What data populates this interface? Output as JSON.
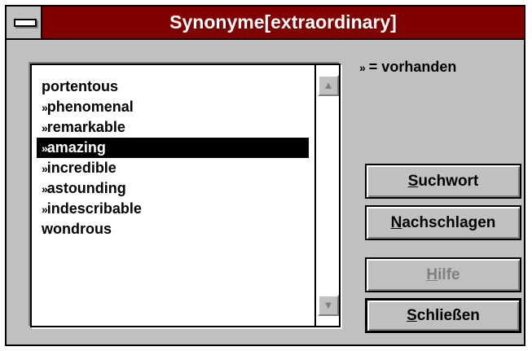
{
  "window": {
    "title": "Synonyme[extraordinary]"
  },
  "legend": {
    "marker": "»",
    "text": " = vorhanden"
  },
  "synonyms": {
    "items": [
      {
        "marker": "",
        "label": "portentous"
      },
      {
        "marker": "»",
        "label": "phenomenal"
      },
      {
        "marker": "»",
        "label": "remarkable"
      },
      {
        "marker": "»",
        "label": "amazing",
        "selected": true
      },
      {
        "marker": "»",
        "label": "incredible"
      },
      {
        "marker": "»",
        "label": "astounding"
      },
      {
        "marker": "»",
        "label": "indescribable"
      },
      {
        "marker": "",
        "label": "wondrous"
      }
    ]
  },
  "buttons": {
    "suchwort": {
      "accel": "S",
      "rest": "uchwort"
    },
    "nachschlagen": {
      "accel": "N",
      "rest": "achschlagen"
    },
    "hilfe": {
      "accel": "H",
      "rest": "ilfe",
      "enabled": false
    },
    "schliessen": {
      "accel": "S",
      "rest": "chließen",
      "default": true
    }
  },
  "icons": {
    "scroll_up": "▲",
    "scroll_down": "▼"
  }
}
